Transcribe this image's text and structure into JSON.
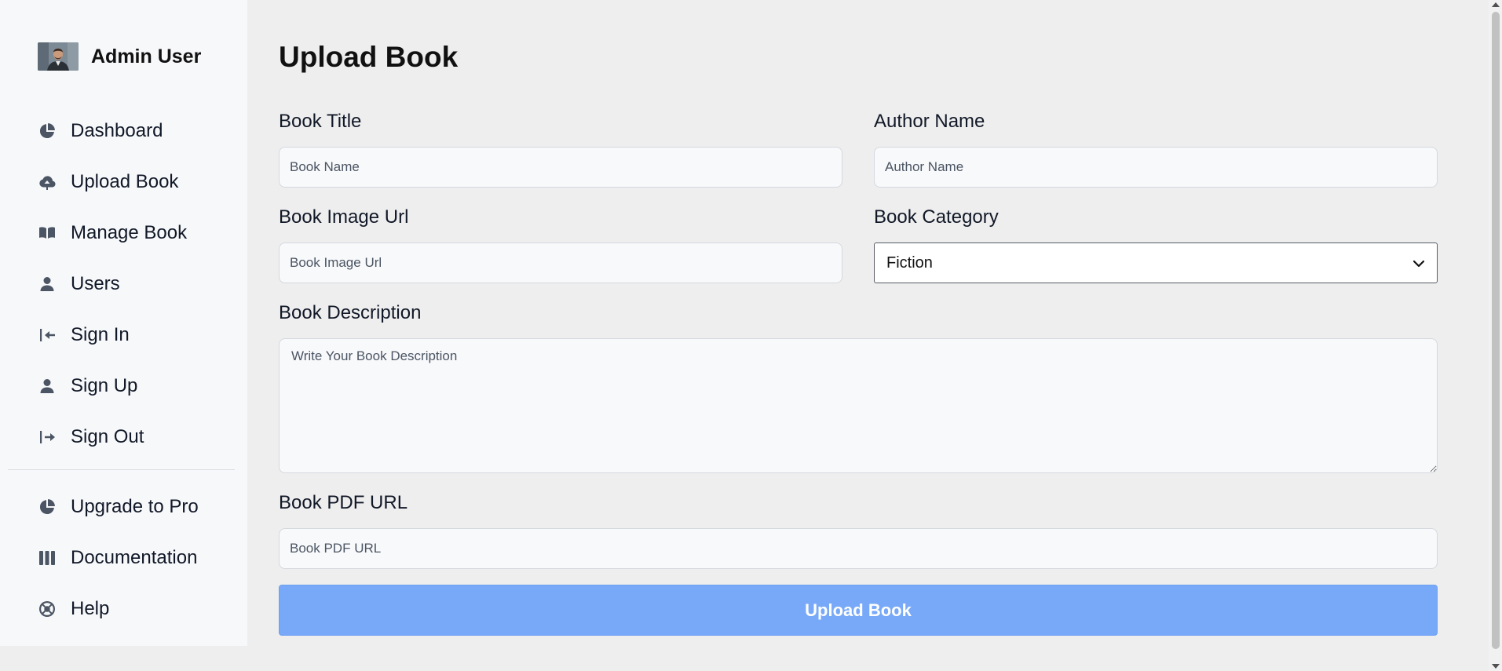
{
  "profile": {
    "name": "Admin User"
  },
  "sidebar": {
    "items": [
      {
        "label": "Dashboard",
        "icon": "pie-chart-icon"
      },
      {
        "label": "Upload Book",
        "icon": "cloud-upload-icon"
      },
      {
        "label": "Manage Book",
        "icon": "open-book-icon"
      },
      {
        "label": "Users",
        "icon": "user-icon"
      },
      {
        "label": "Sign In",
        "icon": "sign-in-icon"
      },
      {
        "label": "Sign Up",
        "icon": "user-icon"
      },
      {
        "label": "Sign Out",
        "icon": "sign-out-icon"
      }
    ],
    "secondary_items": [
      {
        "label": "Upgrade to Pro",
        "icon": "pie-chart-icon"
      },
      {
        "label": "Documentation",
        "icon": "columns-icon"
      },
      {
        "label": "Help",
        "icon": "lifebuoy-icon"
      }
    ]
  },
  "main": {
    "title": "Upload Book",
    "form": {
      "book_title": {
        "label": "Book Title",
        "placeholder": "Book Name",
        "value": ""
      },
      "author_name": {
        "label": "Author Name",
        "placeholder": "Author Name",
        "value": ""
      },
      "image_url": {
        "label": "Book Image Url",
        "placeholder": "Book Image Url",
        "value": ""
      },
      "category": {
        "label": "Book Category",
        "selected": "Fiction"
      },
      "description": {
        "label": "Book Description",
        "placeholder": "Write Your Book Description",
        "value": ""
      },
      "pdf_url": {
        "label": "Book PDF URL",
        "placeholder": "Book PDF URL",
        "value": ""
      },
      "submit_label": "Upload Book"
    }
  },
  "colors": {
    "sidebar_bg": "#f7f8fa",
    "page_bg": "#eeeeee",
    "button_bg": "#78a9f8",
    "icon": "#4b5563"
  }
}
